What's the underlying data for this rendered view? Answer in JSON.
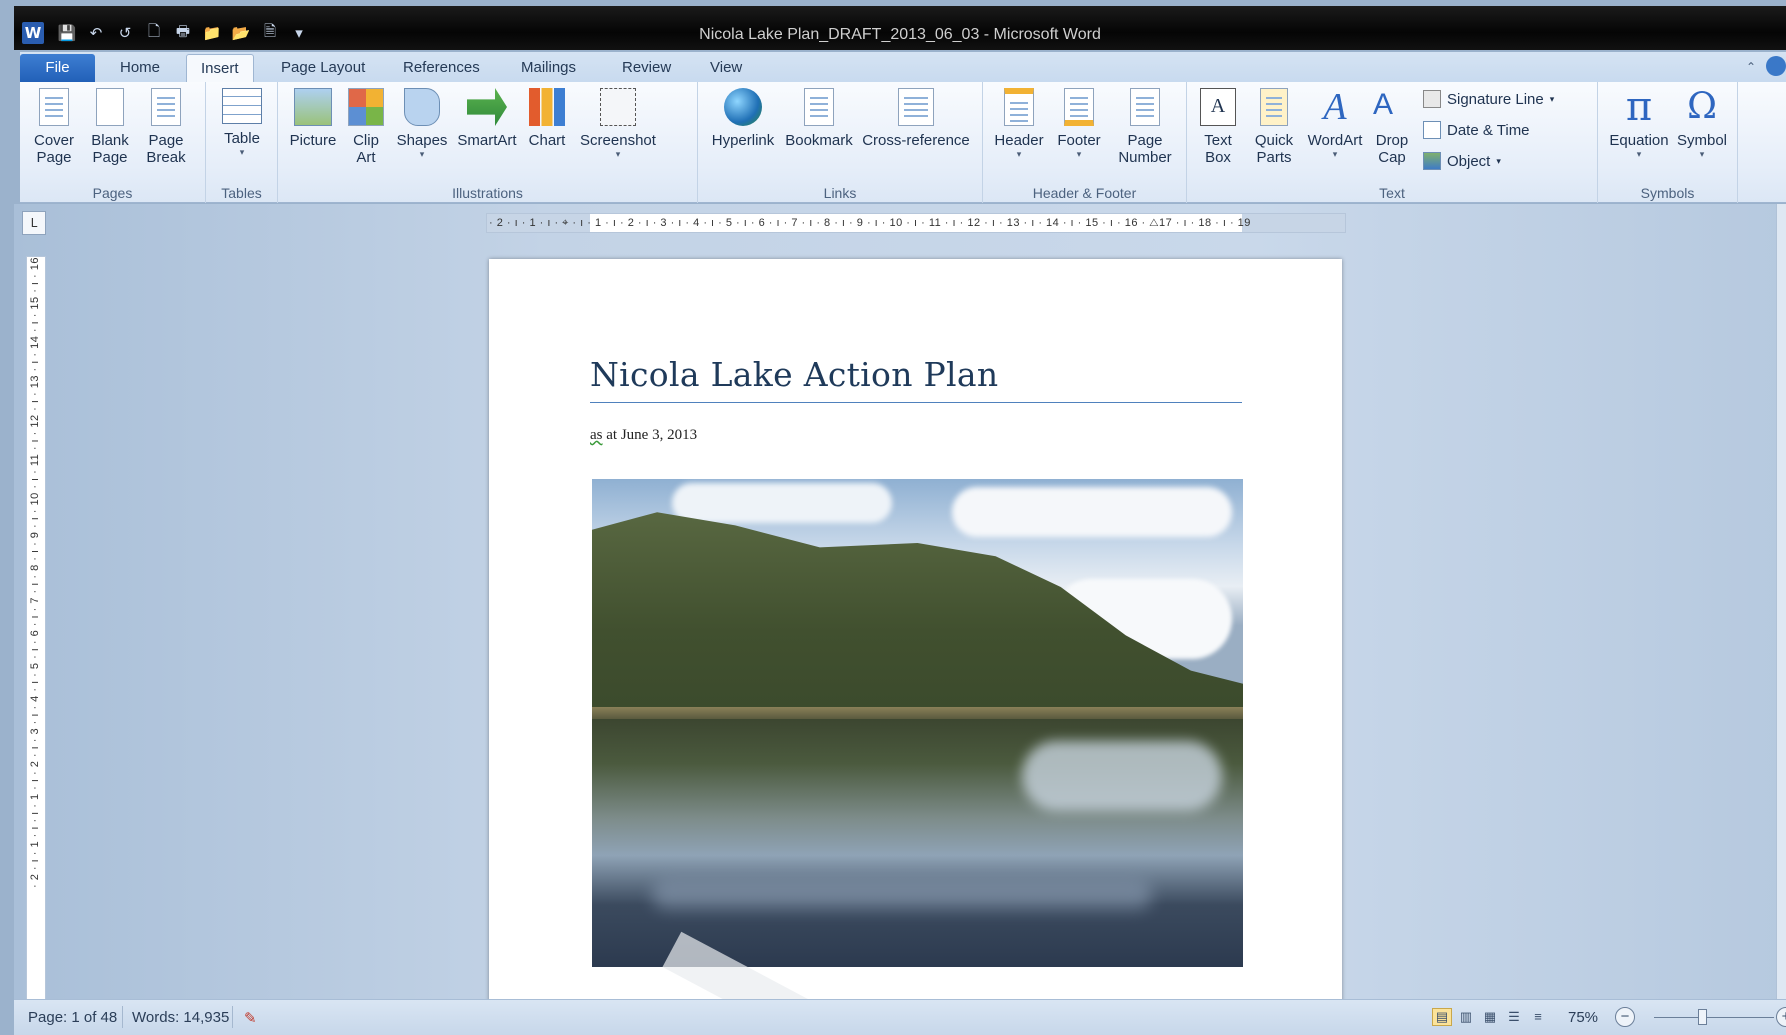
{
  "window": {
    "title": "Nicola Lake Plan_DRAFT_2013_06_03  -  Microsoft Word",
    "app_icon": "W"
  },
  "quick_access": [
    {
      "name": "save-icon",
      "glyph": "💾"
    },
    {
      "name": "undo-icon",
      "glyph": "↶"
    },
    {
      "name": "redo-icon",
      "glyph": "↺"
    },
    {
      "name": "print-preview-icon",
      "glyph": "🗋"
    },
    {
      "name": "print-icon",
      "glyph": "🖶"
    },
    {
      "name": "folder-icon",
      "glyph": "📁"
    },
    {
      "name": "open-icon",
      "glyph": "📂"
    },
    {
      "name": "new-document-icon",
      "glyph": "🗎"
    }
  ],
  "tabs": {
    "file": "File",
    "home": "Home",
    "insert": "Insert",
    "page_layout": "Page Layout",
    "references": "References",
    "mailings": "Mailings",
    "review": "Review",
    "view": "View"
  },
  "ribbon": {
    "pages": {
      "label": "Pages",
      "cover": "Cover\nPage",
      "blank": "Blank\nPage",
      "break": "Page\nBreak"
    },
    "tables": {
      "label": "Tables",
      "table": "Table"
    },
    "illustrations": {
      "label": "Illustrations",
      "picture": "Picture",
      "clipart": "Clip\nArt",
      "shapes": "Shapes",
      "smartart": "SmartArt",
      "chart": "Chart",
      "screenshot": "Screenshot"
    },
    "links": {
      "label": "Links",
      "hyperlink": "Hyperlink",
      "bookmark": "Bookmark",
      "crossref": "Cross-reference"
    },
    "header_footer": {
      "label": "Header & Footer",
      "header": "Header",
      "footer": "Footer",
      "page_number": "Page\nNumber"
    },
    "text": {
      "label": "Text",
      "textbox": "Text\nBox",
      "quickparts": "Quick\nParts",
      "wordart": "WordArt",
      "dropcap": "Drop\nCap",
      "signature": "Signature Line",
      "datetime": "Date & Time",
      "object": "Object"
    },
    "symbols": {
      "label": "Symbols",
      "equation": "Equation",
      "symbol": "Symbol",
      "pi": "π",
      "omega": "Ω"
    }
  },
  "ruler": {
    "corner": "L",
    "horizontal": "· 2 · ı · 1 · ı · ⌖ · ı · 1 · ı · 2 · ı · 3 · ı · 4 · ı · 5 · ı · 6 · ı · 7 · ı · 8 · ı · 9 · ı · 10 · ı · 11 · ı · 12 · ı · 13 · ı · 14 · ı · 15 · ı · 16 · △17 · ı · 18 · ı · 19",
    "vertical": "· 2 · ı · 1 · ı · ı · 1 · ı · 2 · ı · 3 · ı · 4 · ı · 5 · ı · 6 · ı · 7 · ı · 8 · ı · 9 · ı · 10 · ı · 11 · ı · 12 · ı · 13 · ı · 14 · ı · 15 · ı · 16"
  },
  "document": {
    "title": "Nicola Lake Action Plan",
    "subtitle_prefix": "as",
    "subtitle_rest": " at June 3, 2013"
  },
  "status": {
    "page": "Page: 1 of 48",
    "words": "Words: 14,935",
    "zoom": "75%",
    "zoom_level_percent": 75
  },
  "colors": {
    "accent": "#2b579a",
    "title_rule": "#4f81bd"
  }
}
